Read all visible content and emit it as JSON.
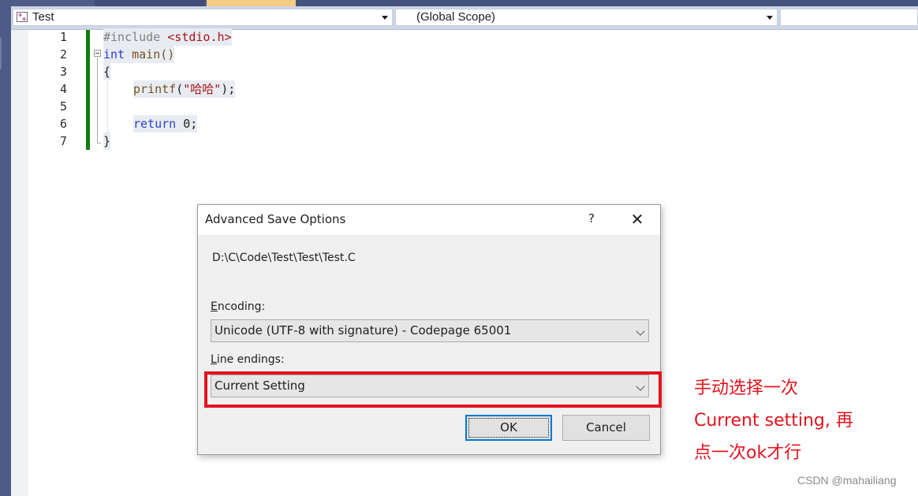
{
  "navbar": {
    "project": "Test",
    "scope": "(Global Scope)",
    "member": ""
  },
  "editor": {
    "line_numbers": [
      "1",
      "2",
      "3",
      "4",
      "5",
      "6",
      "7"
    ],
    "lines": {
      "l1_directive": "#include ",
      "l1_header": "<stdio.h>",
      "l2_kw": "int",
      "l2_rest": " main()",
      "l3": "{",
      "l4_fn": "printf",
      "l4_open": "(",
      "l4_str": "\"哈哈\"",
      "l4_close": ");",
      "l6_kw": "return",
      "l6_rest": " 0;",
      "l7": "}"
    }
  },
  "dialog": {
    "title": "Advanced Save Options",
    "help": "?",
    "close": "✕",
    "file_path": "D:\\C\\Code\\Test\\Test\\Test.C",
    "encoding_label_first": "E",
    "encoding_label_rest": "ncoding:",
    "encoding_value": "Unicode (UTF-8 with signature) - Codepage 65001",
    "line_endings_label_first": "L",
    "line_endings_label_rest": "ine endings:",
    "line_endings_value": "Current Setting",
    "ok": "OK",
    "cancel": "Cancel"
  },
  "annotation": {
    "line1": "手动选择一次",
    "line2": "Current setting, 再",
    "line3": "点一次ok才行",
    "color": "#e3141e"
  },
  "watermark": "CSDN @mahailiang"
}
